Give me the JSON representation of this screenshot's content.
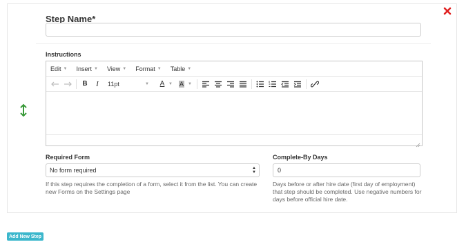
{
  "step": {
    "name_label": "Step Name*",
    "name_value": "",
    "name_placeholder": ""
  },
  "instructions": {
    "label": "Instructions",
    "menus": [
      {
        "label": "Edit"
      },
      {
        "label": "Insert"
      },
      {
        "label": "View"
      },
      {
        "label": "Format"
      },
      {
        "label": "Table"
      }
    ],
    "font_size": "11pt",
    "bold_label": "B",
    "italic_label": "I",
    "text_color_label": "A",
    "bg_color_label": "A",
    "content": ""
  },
  "required_form": {
    "label": "Required Form",
    "selected": "No form required",
    "help": "If this step requires the completion of a form, select it from the list. You can create new Forms on the Settings page"
  },
  "complete_by": {
    "label": "Complete-By Days",
    "value": "0",
    "help": "Days before or after hire date (first day of employment) that step should be completed. Use negative numbers for days before official hire date."
  },
  "add_step_label": "Add New Step",
  "colors": {
    "close": "#e02020",
    "drag_handle": "#3a9a3a",
    "add_button": "#3cb7cc"
  },
  "icons": {
    "close": "close-icon",
    "drag": "drag-vertical-icon",
    "undo": "undo-icon",
    "redo": "redo-icon",
    "align_left": "align-left-icon",
    "align_center": "align-center-icon",
    "align_right": "align-right-icon",
    "align_justify": "align-justify-icon",
    "bullet_list": "bullet-list-icon",
    "numbered_list": "numbered-list-icon",
    "outdent": "outdent-icon",
    "indent": "indent-icon",
    "link": "link-icon"
  }
}
